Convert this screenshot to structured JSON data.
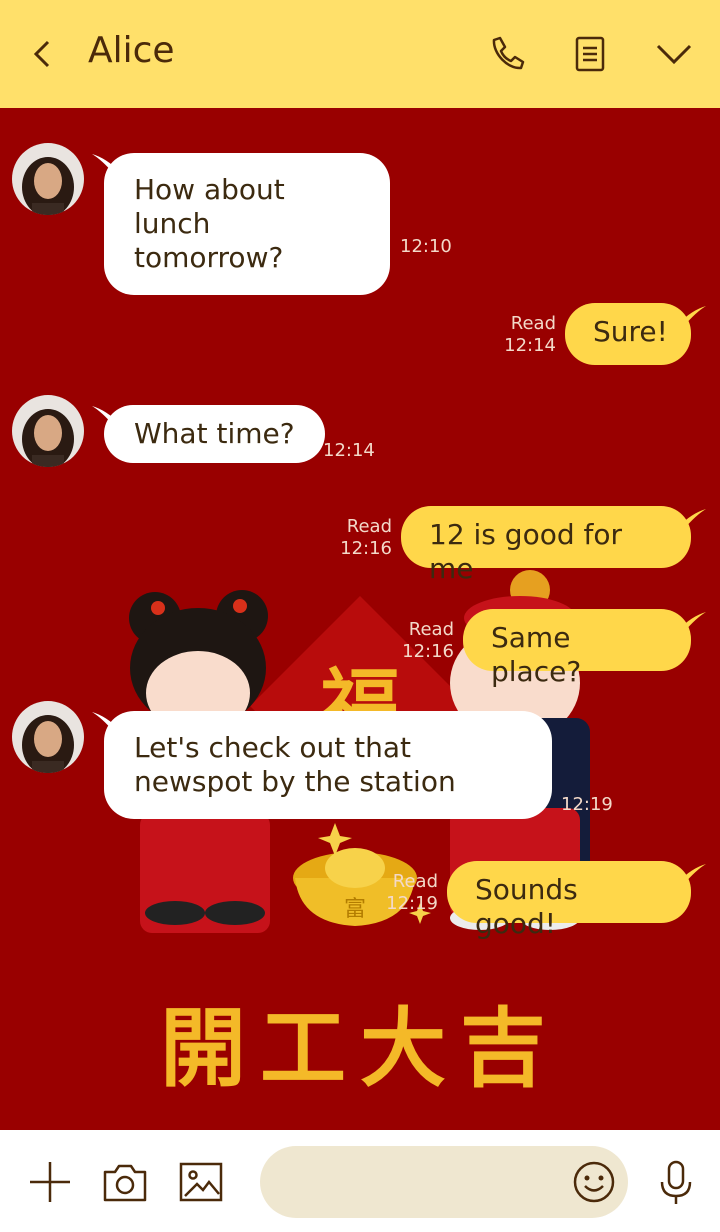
{
  "header": {
    "title": "Alice"
  },
  "messages": [
    {
      "dir": "in",
      "text": "How about lunch tomorrow?",
      "time": "12:10"
    },
    {
      "dir": "out",
      "text": "Sure!",
      "read": "Read",
      "time": "12:14"
    },
    {
      "dir": "in",
      "text": "What time?",
      "time": "12:14"
    },
    {
      "dir": "out",
      "text": "12 is good for me",
      "read": "Read",
      "time": "12:16"
    },
    {
      "dir": "out",
      "text": "Same place?",
      "read": "Read",
      "time": "12:16"
    },
    {
      "dir": "in",
      "text": "Let's check out that newspot by the station",
      "time": "12:19"
    },
    {
      "dir": "out",
      "text": "Sounds good!",
      "read": "Read",
      "time": "12:19"
    }
  ],
  "background": {
    "greeting": "開工大吉",
    "fu_char": "福",
    "ingot_char": "富"
  },
  "colors": {
    "header": "#ffe06a",
    "chat_bg": "#990000",
    "out_bubble": "#ffd74a",
    "in_bubble": "#ffffff",
    "gold": "#f4b928"
  },
  "footer": {
    "icons": [
      "plus-icon",
      "camera-icon",
      "image-icon",
      "emoji-icon",
      "microphone-icon"
    ],
    "input_placeholder": ""
  }
}
